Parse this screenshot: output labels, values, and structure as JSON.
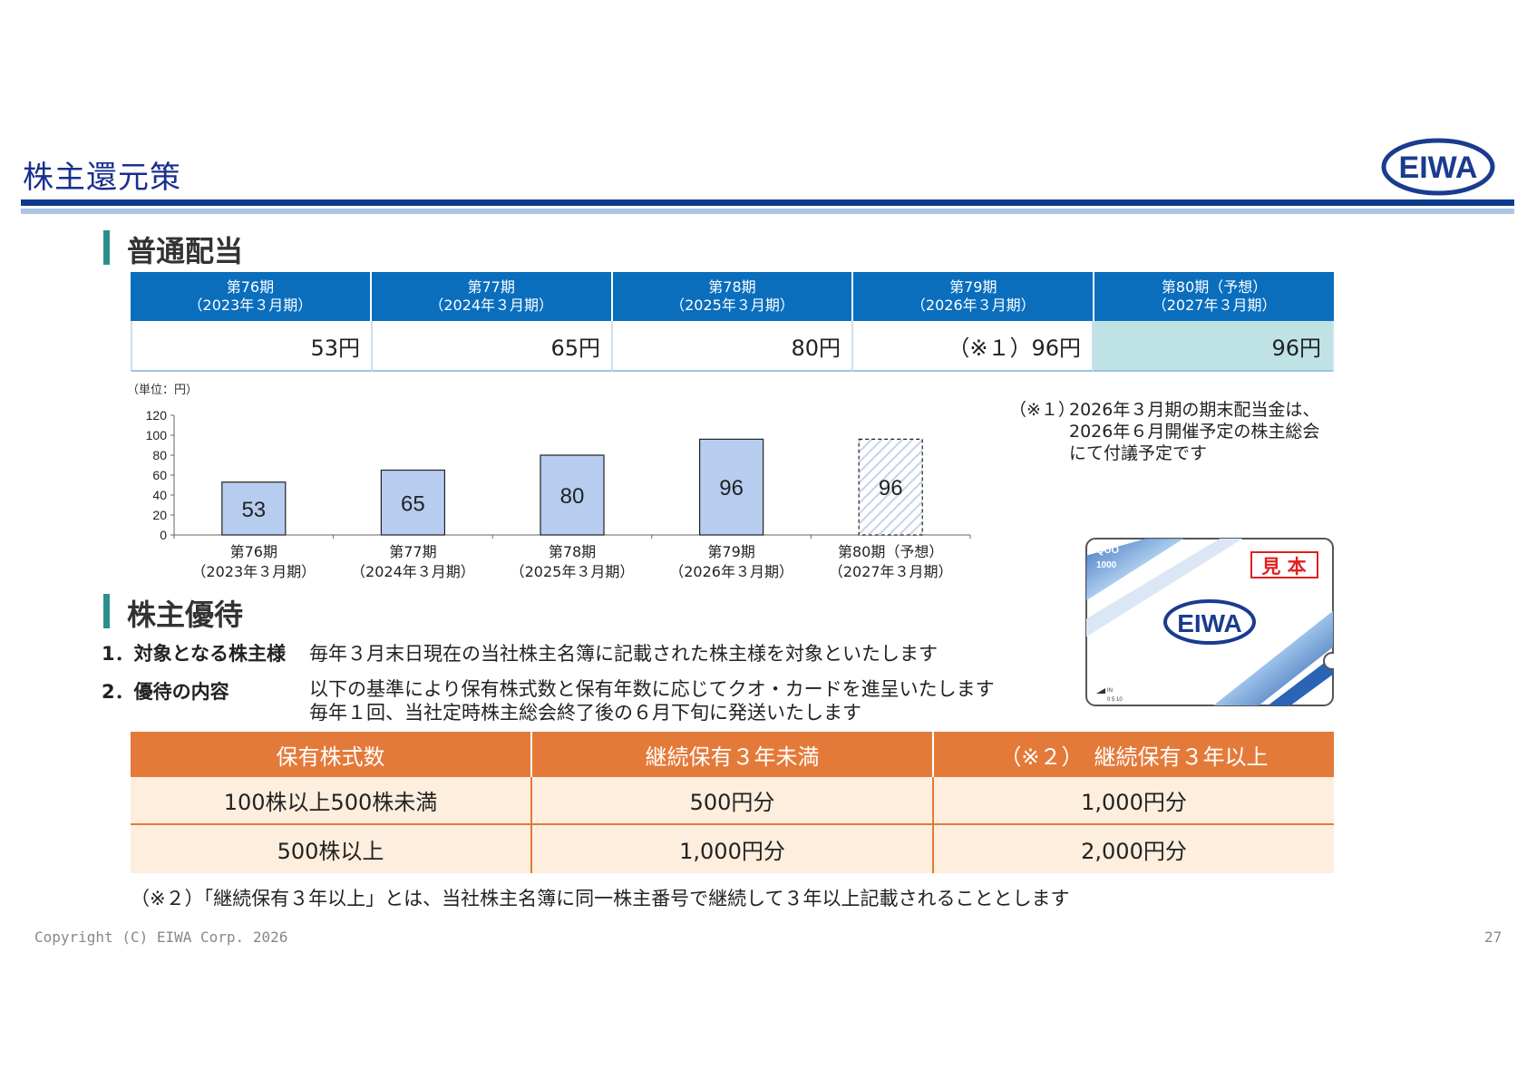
{
  "header": {
    "title": "株主還元策",
    "logo_text": "EIWA"
  },
  "dividend_section": {
    "title": "普通配当",
    "table": {
      "headers": [
        {
          "period": "第76期",
          "fiscal": "（2023年３月期）"
        },
        {
          "period": "第77期",
          "fiscal": "（2024年３月期）"
        },
        {
          "period": "第78期",
          "fiscal": "（2025年３月期）"
        },
        {
          "period": "第79期",
          "fiscal": "（2026年３月期）"
        },
        {
          "period": "第80期（予想）",
          "fiscal": "（2027年３月期）"
        }
      ],
      "values": [
        "53円",
        "65円",
        "80円",
        "（※１）96円",
        "96円"
      ]
    },
    "note": {
      "mark": "（※１）",
      "lines": [
        "2026年３月期の期末配当金は、",
        "2026年６月開催予定の株主総会",
        "にて付議予定です"
      ]
    }
  },
  "chart_data": {
    "type": "bar",
    "unit_label": "（単位：円）",
    "categories": [
      [
        "第76期",
        "（2023年３月期）"
      ],
      [
        "第77期",
        "（2024年３月期）"
      ],
      [
        "第78期",
        "（2025年３月期）"
      ],
      [
        "第79期",
        "（2026年３月期）"
      ],
      [
        "第80期（予想）",
        "（2027年３月期）"
      ]
    ],
    "values": [
      53,
      65,
      80,
      96,
      96
    ],
    "forecast_index": 4,
    "yticks": [
      0,
      20,
      40,
      60,
      80,
      100,
      120
    ],
    "ylim": [
      0,
      120
    ],
    "grid": false,
    "colors": {
      "bar": "#b7cdf0",
      "bar_border": "#222222",
      "forecast_hatch": "#c5d3e8"
    }
  },
  "quo_card": {
    "brand": "QUO",
    "amount": "1000",
    "sample_label": "見 本",
    "logo_text": "EIWA",
    "in_label": "IN",
    "scale": "0  5  10"
  },
  "benefit_section": {
    "title": "株主優待",
    "items": [
      {
        "label": "1．対象となる株主様",
        "text": [
          "毎年３月末日現在の当社株主名簿に記載された株主様を対象といたします"
        ]
      },
      {
        "label": "2．優待の内容",
        "text": [
          "以下の基準により保有株式数と保有年数に応じてクオ・カードを進呈いたします",
          "毎年１回、当社定時株主総会終了後の６月下旬に発送いたします"
        ]
      }
    ],
    "table": {
      "headers": [
        "保有株式数",
        "継続保有３年未満",
        "（※２）　継続保有３年以上"
      ],
      "rows": [
        [
          "100株以上500株未満",
          "500円分",
          "1,000円分"
        ],
        [
          "500株以上",
          "1,000円分",
          "2,000円分"
        ]
      ]
    },
    "note": "（※２）「継続保有３年以上」とは、当社株主名簿に同一株主番号で継続して３年以上記載されることとします"
  },
  "footer": {
    "copyright": "Copyright (C) EIWA Corp. 2026",
    "page_number": "27"
  }
}
